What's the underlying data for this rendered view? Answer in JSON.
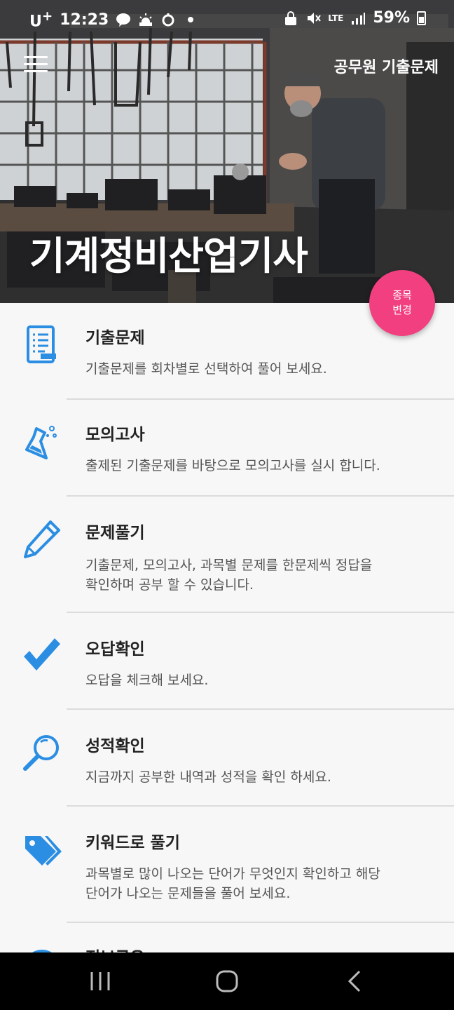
{
  "status_bar": {
    "carrier": "U",
    "carrier_sup": "+",
    "time": "12:23",
    "network": "LTE",
    "battery": "59%",
    "icons": [
      "kakaotalk-icon",
      "weather-icon",
      "alarm-icon",
      "dot-icon",
      "lock-icon",
      "mute-icon",
      "signal-icon",
      "battery-icon"
    ]
  },
  "header": {
    "menu_icon": "hamburger-icon",
    "app_title": "공무원 기출문제",
    "exam_title": "기계정비산업기사"
  },
  "fab": {
    "line1": "종목",
    "line2": "변경",
    "color": "#f23f7f"
  },
  "accent_color": "#2b8ee3",
  "menu": [
    {
      "icon": "document-icon",
      "title": "기출문제",
      "desc": "기출문제를 회차별로 선택하여 풀어 보세요."
    },
    {
      "icon": "flask-icon",
      "title": "모의고사",
      "desc": "출제된 기출문제를 바탕으로 모의고사를 실시 합니다."
    },
    {
      "icon": "pencil-icon",
      "title": "문제풀기",
      "desc": "기출문제, 모의고사, 과목별 문제를 한문제씩 정답을\n확인하며 공부 할 수 있습니다."
    },
    {
      "icon": "checkmark-icon",
      "title": "오답확인",
      "desc": "오답을 체크해 보세요."
    },
    {
      "icon": "magnifier-icon",
      "title": "성적확인",
      "desc": "지금까지 공부한 내역과 성적을 확인 하세요."
    },
    {
      "icon": "tags-icon",
      "title": "키워드로 풀기",
      "desc": "과목별로 많이 나오는 단어가 무엇인지 확인하고 해당\n단어가 나오는 문제들을 풀어 보세요."
    },
    {
      "icon": "info-icon",
      "title": "정보공유",
      "desc": ""
    }
  ],
  "nav_bar": {
    "buttons": [
      "recent-apps-icon",
      "home-icon",
      "back-icon"
    ]
  }
}
